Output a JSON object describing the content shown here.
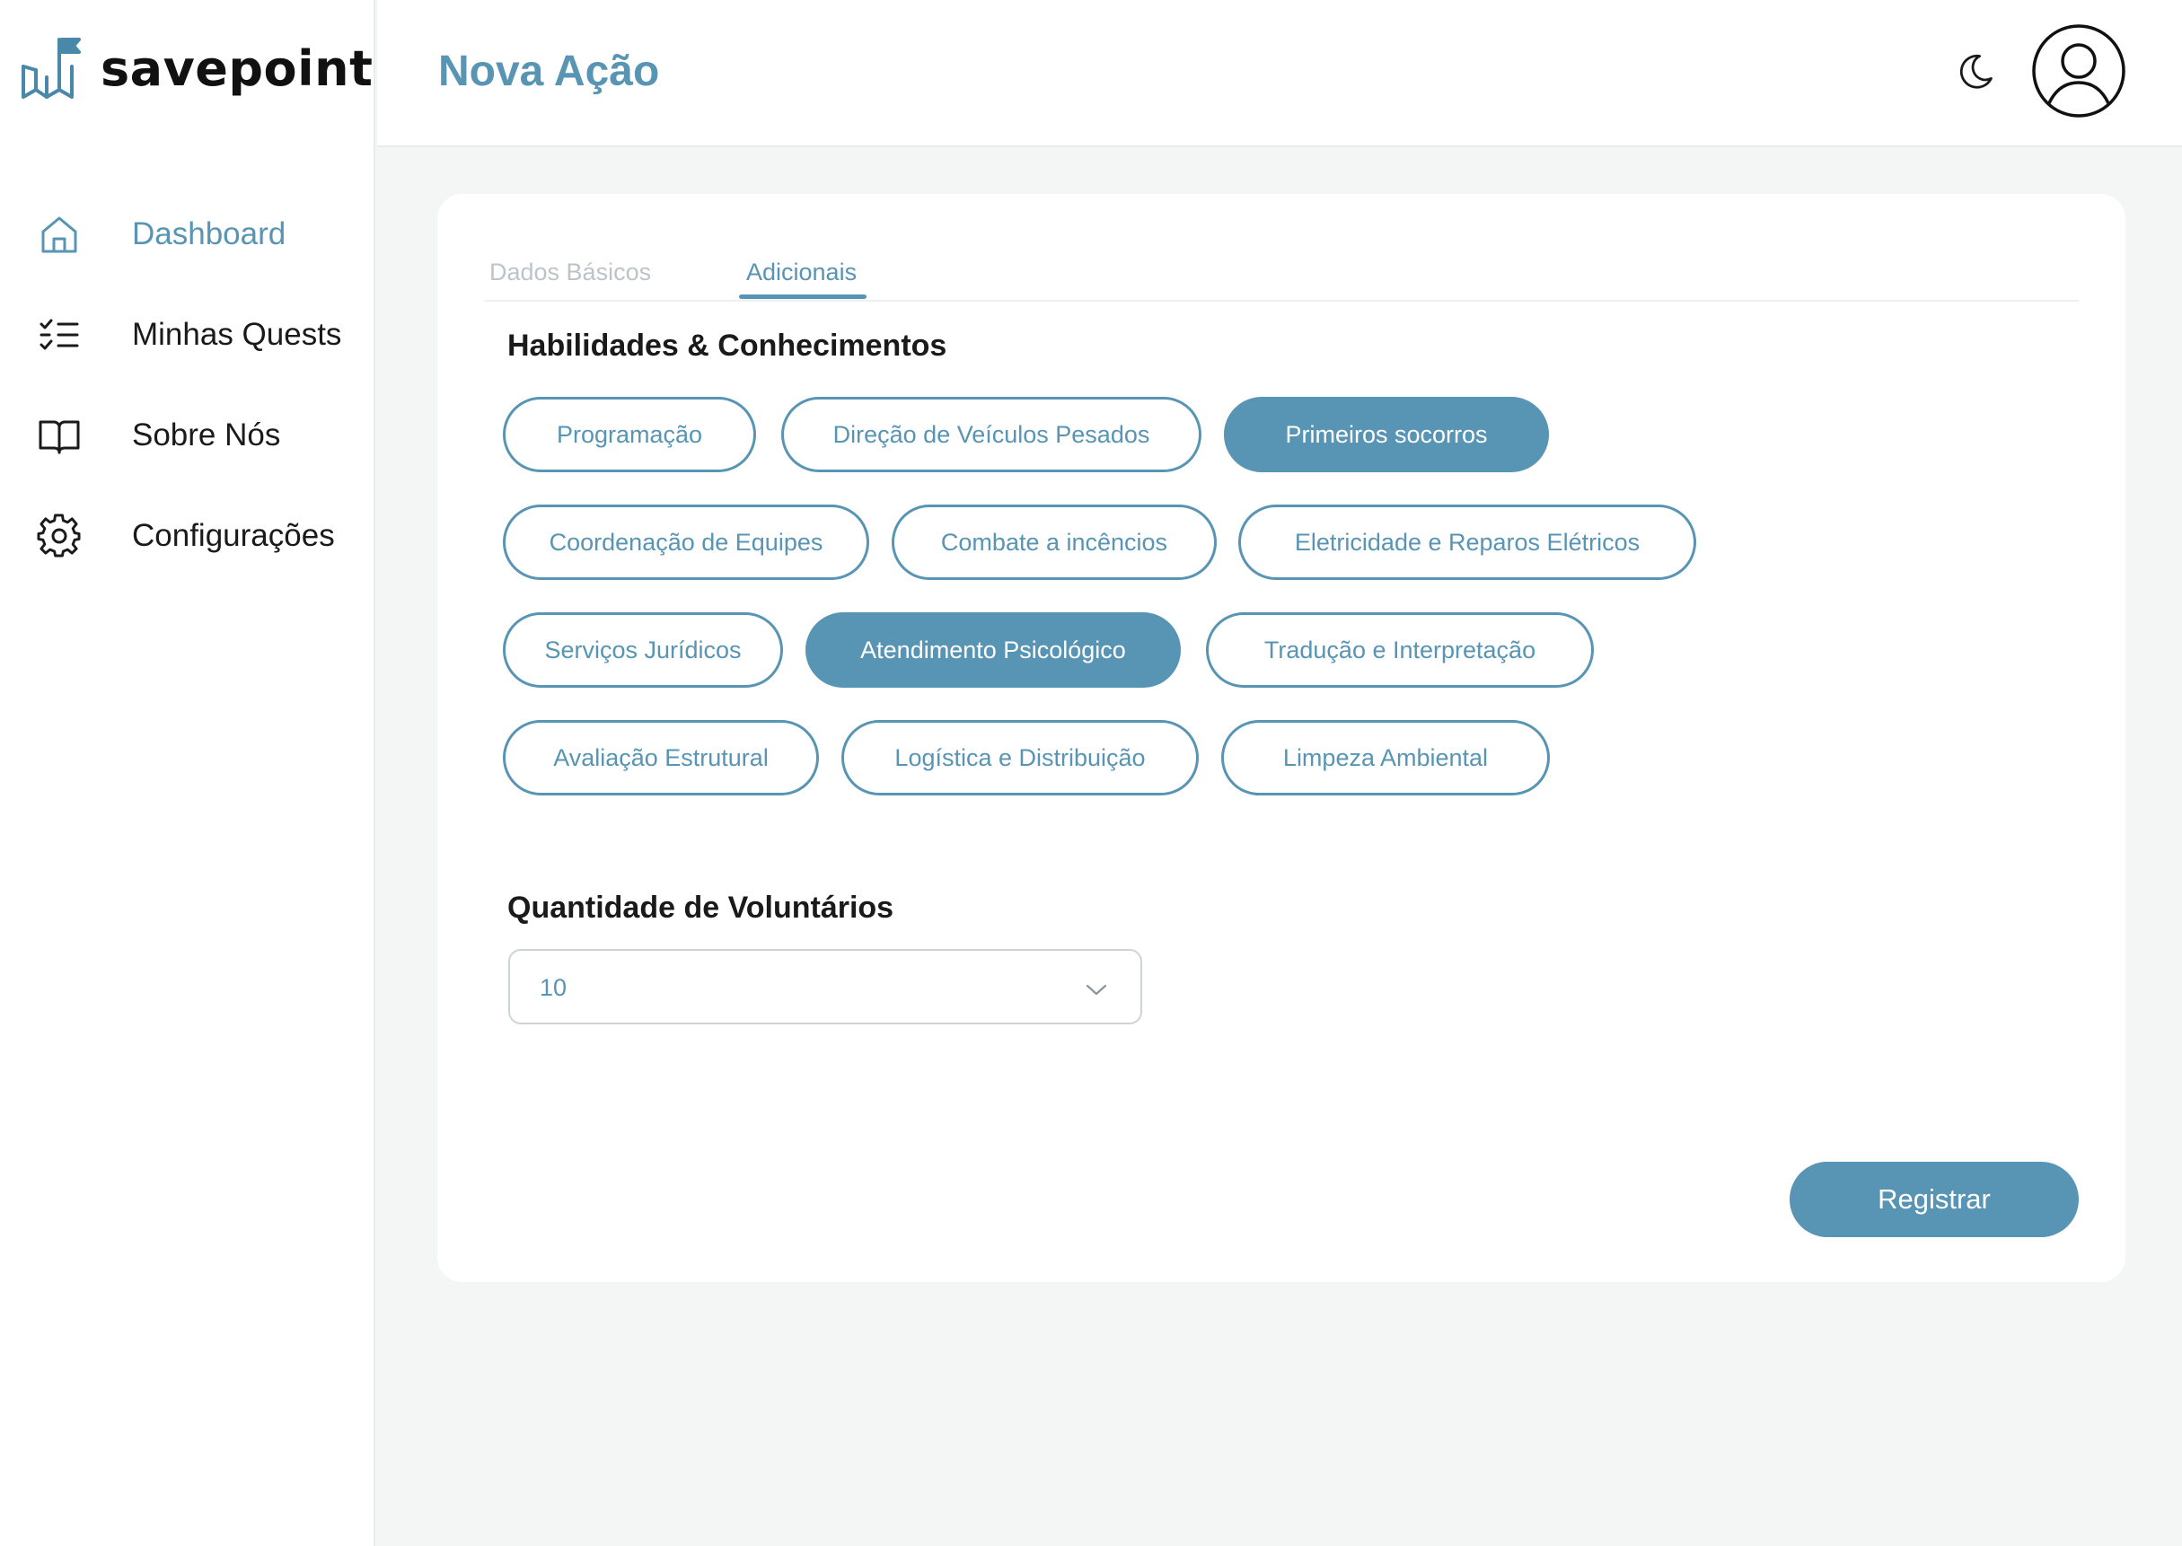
{
  "app": {
    "logo_text": "savepoint"
  },
  "sidebar": {
    "items": [
      {
        "label": "Dashboard",
        "icon": "home-icon"
      },
      {
        "label": "Minhas Quests",
        "icon": "checklist-icon"
      },
      {
        "label": "Sobre Nós",
        "icon": "book-open-icon"
      },
      {
        "label": "Configurações",
        "icon": "gear-icon"
      }
    ],
    "active_index": 0
  },
  "header": {
    "title": "Nova Ação",
    "theme_icon": "moon-icon",
    "avatar_icon": "user-avatar-icon"
  },
  "form": {
    "tabs": [
      {
        "label": "Dados Básicos",
        "active": false
      },
      {
        "label": "Adicionais",
        "active": true
      }
    ],
    "skills": {
      "title": "Habilidades & Conhecimentos",
      "options": [
        {
          "label": "Programação",
          "selected": false
        },
        {
          "label": "Direção de Veículos Pesados",
          "selected": false
        },
        {
          "label": "Primeiros socorros",
          "selected": true
        },
        {
          "label": "Coordenação de Equipes",
          "selected": false
        },
        {
          "label": "Combate a incêncios",
          "selected": false
        },
        {
          "label": "Eletricidade e Reparos Elétricos",
          "selected": false
        },
        {
          "label": "Serviços Jurídicos",
          "selected": false
        },
        {
          "label": "Atendimento Psicológico",
          "selected": true
        },
        {
          "label": "Tradução e Interpretação",
          "selected": false
        },
        {
          "label": "Avaliação Estrutural",
          "selected": false
        },
        {
          "label": "Logística e Distribuição",
          "selected": false
        },
        {
          "label": "Limpeza Ambiental",
          "selected": false
        }
      ]
    },
    "volunteers": {
      "title": "Quantidade de Voluntários",
      "value": "10"
    },
    "submit_label": "Registrar"
  },
  "colors": {
    "accent": "#5894b3",
    "text": "#1a1a1a",
    "muted_tab": "#bcc4c8",
    "background": "#f4f6f5"
  }
}
